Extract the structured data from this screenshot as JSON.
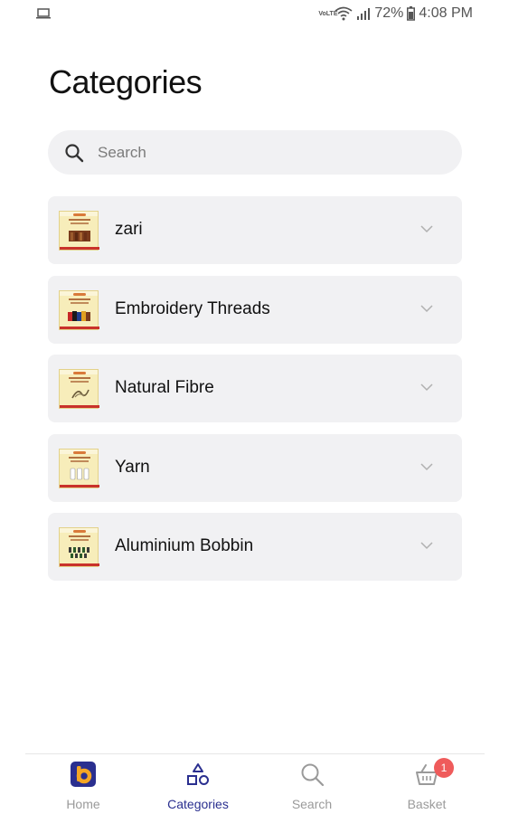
{
  "status_bar": {
    "volte": "VoLTE",
    "battery": "72%",
    "time": "4:08 PM"
  },
  "page": {
    "title": "Categories"
  },
  "search": {
    "placeholder": "Search",
    "value": ""
  },
  "categories": [
    {
      "label": "zari",
      "art": "brown"
    },
    {
      "label": "Embroidery Threads",
      "art": "multi"
    },
    {
      "label": "Natural Fibre",
      "art": "script"
    },
    {
      "label": "Yarn",
      "art": "cones"
    },
    {
      "label": "Aluminium Bobbin",
      "art": "bobbins"
    }
  ],
  "nav": {
    "items": [
      {
        "label": "Home",
        "icon": "brand-logo-icon",
        "active": false
      },
      {
        "label": "Categories",
        "icon": "shapes-icon",
        "active": true
      },
      {
        "label": "Search",
        "icon": "search-icon",
        "active": false
      },
      {
        "label": "Basket",
        "icon": "basket-icon",
        "active": false
      }
    ],
    "basket_badge": "1"
  },
  "colors": {
    "accent": "#2a2f8f",
    "brand_orange": "#f5a623",
    "badge": "#ef5b5b",
    "card_bg": "#f1f1f3"
  }
}
